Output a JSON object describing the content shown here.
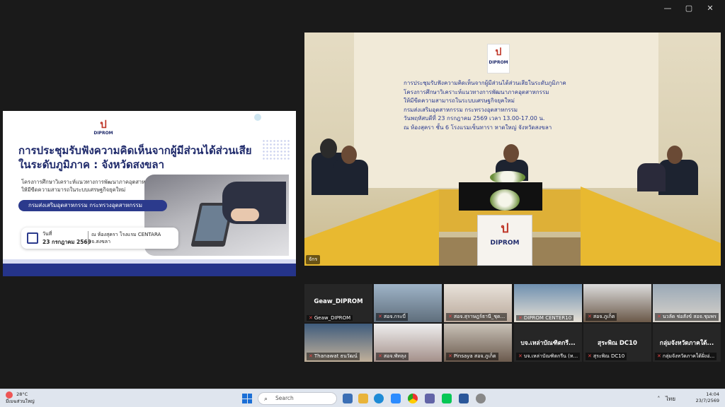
{
  "window": {
    "controls": [
      "—",
      "▢",
      "✕"
    ]
  },
  "slide": {
    "logo_mark": "ป",
    "logo_text": "DIPROM",
    "title_line1": "การประชุมรับฟังความคิดเห็นจากผู้มีส่วนได้ส่วนเสีย",
    "title_line2": "ในระดับภูมิภาค : จังหวัดสงขลา",
    "subtitle_line1": "โครงการศึกษาวิเคราะห์แนวทางการพัฒนาภาคอุตสาหกรรม",
    "subtitle_line2": "ให้มีขีดความสามารถในระบบเศรษฐกิจยุคใหม่",
    "org_pill": "กรมส่งเสริมอุตสาหกรรม กระทรวงอุตสาหกรรม",
    "date_label": "วันที่",
    "date_value": "23 กรกฎาคม 2569",
    "venue_line1": "ณ ห้องสุครา โรงแรม CENTARA",
    "venue_line2": "จ.สงขลา"
  },
  "main_video": {
    "logo_mark": "ป",
    "logo_text": "DIPROM",
    "banner_lines": [
      "การประชุมรับฟังความคิดเห็นจากผู้มีส่วนได้ส่วนเสียในระดับภูมิภาค",
      "โครงการศึกษาวิเคราะห์แนวทางการพัฒนาภาคอุตสาหกรรม",
      "ให้มีขีดความสามารถในระบบเศรษฐกิจยุคใหม่",
      "กรมส่งเสริมอุตสาหกรรม กระทรวงอุตสาหกรรม",
      "วันพฤหัสบดีที่ 23 กรกฎาคม 2569 เวลา 13.00-17.00 น.",
      "ณ ห้องสุครา ชั้น 6 โรงแรมเซ็นทารา หาดใหญ่ จังหวัดสงขลา"
    ],
    "podium_mark": "ป",
    "podium_text": "DIPROM",
    "tag": "จักร"
  },
  "gallery": {
    "tiles": [
      {
        "big": "Geaw_DIPROM",
        "name": "Geaw_DIPROM",
        "video": false
      },
      {
        "big": "",
        "name": "สอจ.กระบี่",
        "video": true
      },
      {
        "big": "",
        "name": "สอจ.สุราษฎร์ธานี_ชุด...",
        "video": true
      },
      {
        "big": "",
        "name": "DIPROM CENTER10",
        "video": true
      },
      {
        "big": "",
        "name": "สอจ.ภูเก็ต",
        "video": true
      },
      {
        "big": "",
        "name": "นวลัด ช่อสังข์ สอจ.ชุมพร",
        "video": true
      },
      {
        "big": "",
        "name": "Thanawat ธนวัฒน์",
        "video": true
      },
      {
        "big": "",
        "name": "สอจ.พัทลุง",
        "video": true
      },
      {
        "big": "",
        "name": "Pinsaya สอจ.ภูเก็ต",
        "video": true
      },
      {
        "big": "บจ.เหล่าบัณฑิตกรี...",
        "name": "บจ.เหล่าบัณฑิตกรีน (ท...",
        "video": false
      },
      {
        "big": "สุระพิณ DC10",
        "name": "สุระพิณ DC10",
        "video": false
      },
      {
        "big": "กลุ่มจังหวัดภาคใต้...",
        "name": "กลุ่มจังหวัดภาคใต้ฝั่งอ่...",
        "video": false
      }
    ]
  },
  "taskbar": {
    "temp": "28°C",
    "weather_text": "มีเมฆส่วนใหญ่",
    "search_placeholder": "Search",
    "lang": "ไทย",
    "time": "14:04",
    "date": "23/7/2569"
  }
}
